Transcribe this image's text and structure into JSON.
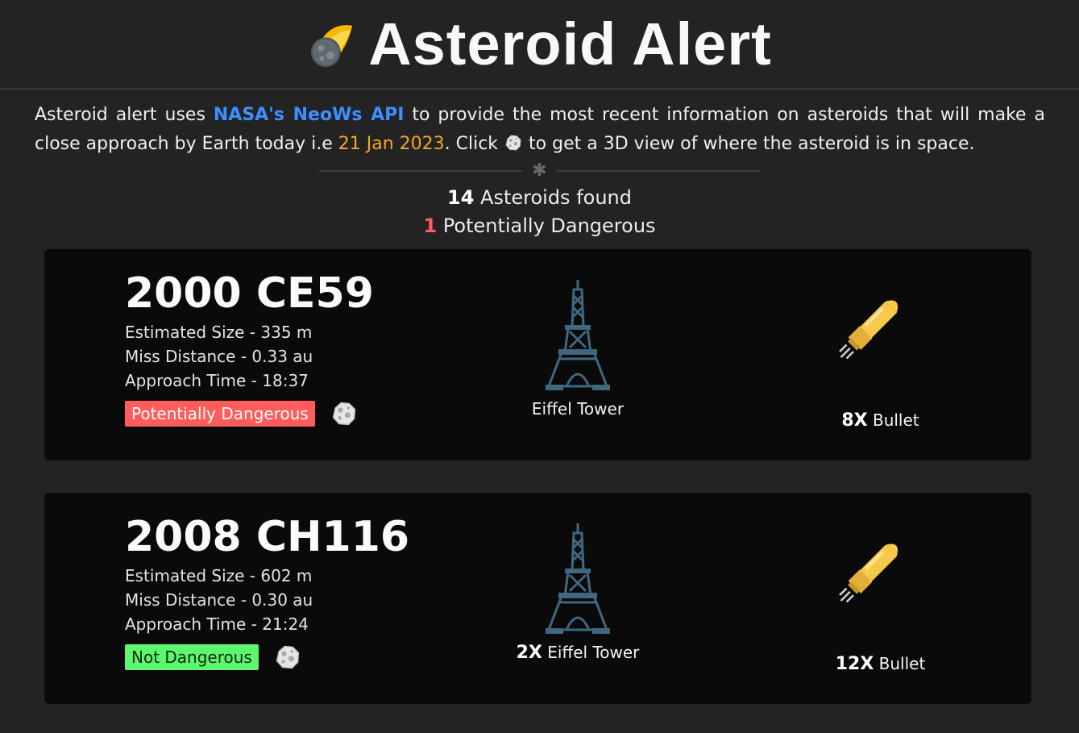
{
  "header": {
    "title": "Asteroid Alert",
    "logo_icon": "meteor-icon"
  },
  "intro": {
    "part1": "Asteroid alert uses ",
    "api_link": "NASA's NeoWs API",
    "part2": " to provide the most recent information on asteroids that will make a close approach by Earth today i.e ",
    "date": "21 Jan 2023",
    "part3": ". Click ",
    "part4": " to get a 3D view of where the asteroid is in space."
  },
  "divider": {
    "symbol": "✱"
  },
  "summary": {
    "found_count": "14",
    "found_label": " Asteroids found",
    "danger_count": "1",
    "danger_label": " Potentially Dangerous"
  },
  "asteroids": [
    {
      "name": "2000 CE59",
      "size": "Estimated Size - 335 m",
      "miss": "Miss Distance - 0.33 au",
      "time": "Approach Time - 18:37",
      "status": "Potentially Dangerous",
      "tower_mult": "",
      "tower_label": "Eiffel Tower",
      "bullet_mult": "8X",
      "bullet_label": " Bullet"
    },
    {
      "name": "2008 CH116",
      "size": "Estimated Size - 602 m",
      "miss": "Miss Distance - 0.30 au",
      "time": "Approach Time - 21:24",
      "status": "Not Dangerous",
      "tower_mult": "2X",
      "tower_label": " Eiffel Tower",
      "bullet_mult": "12X",
      "bullet_label": " Bullet"
    }
  ],
  "colors": {
    "background": "#232323",
    "card": "#0a0a0a",
    "link": "#3d8fff",
    "date": "#f5a623",
    "danger": "#ff5c5c",
    "safe": "#5cf76c"
  }
}
